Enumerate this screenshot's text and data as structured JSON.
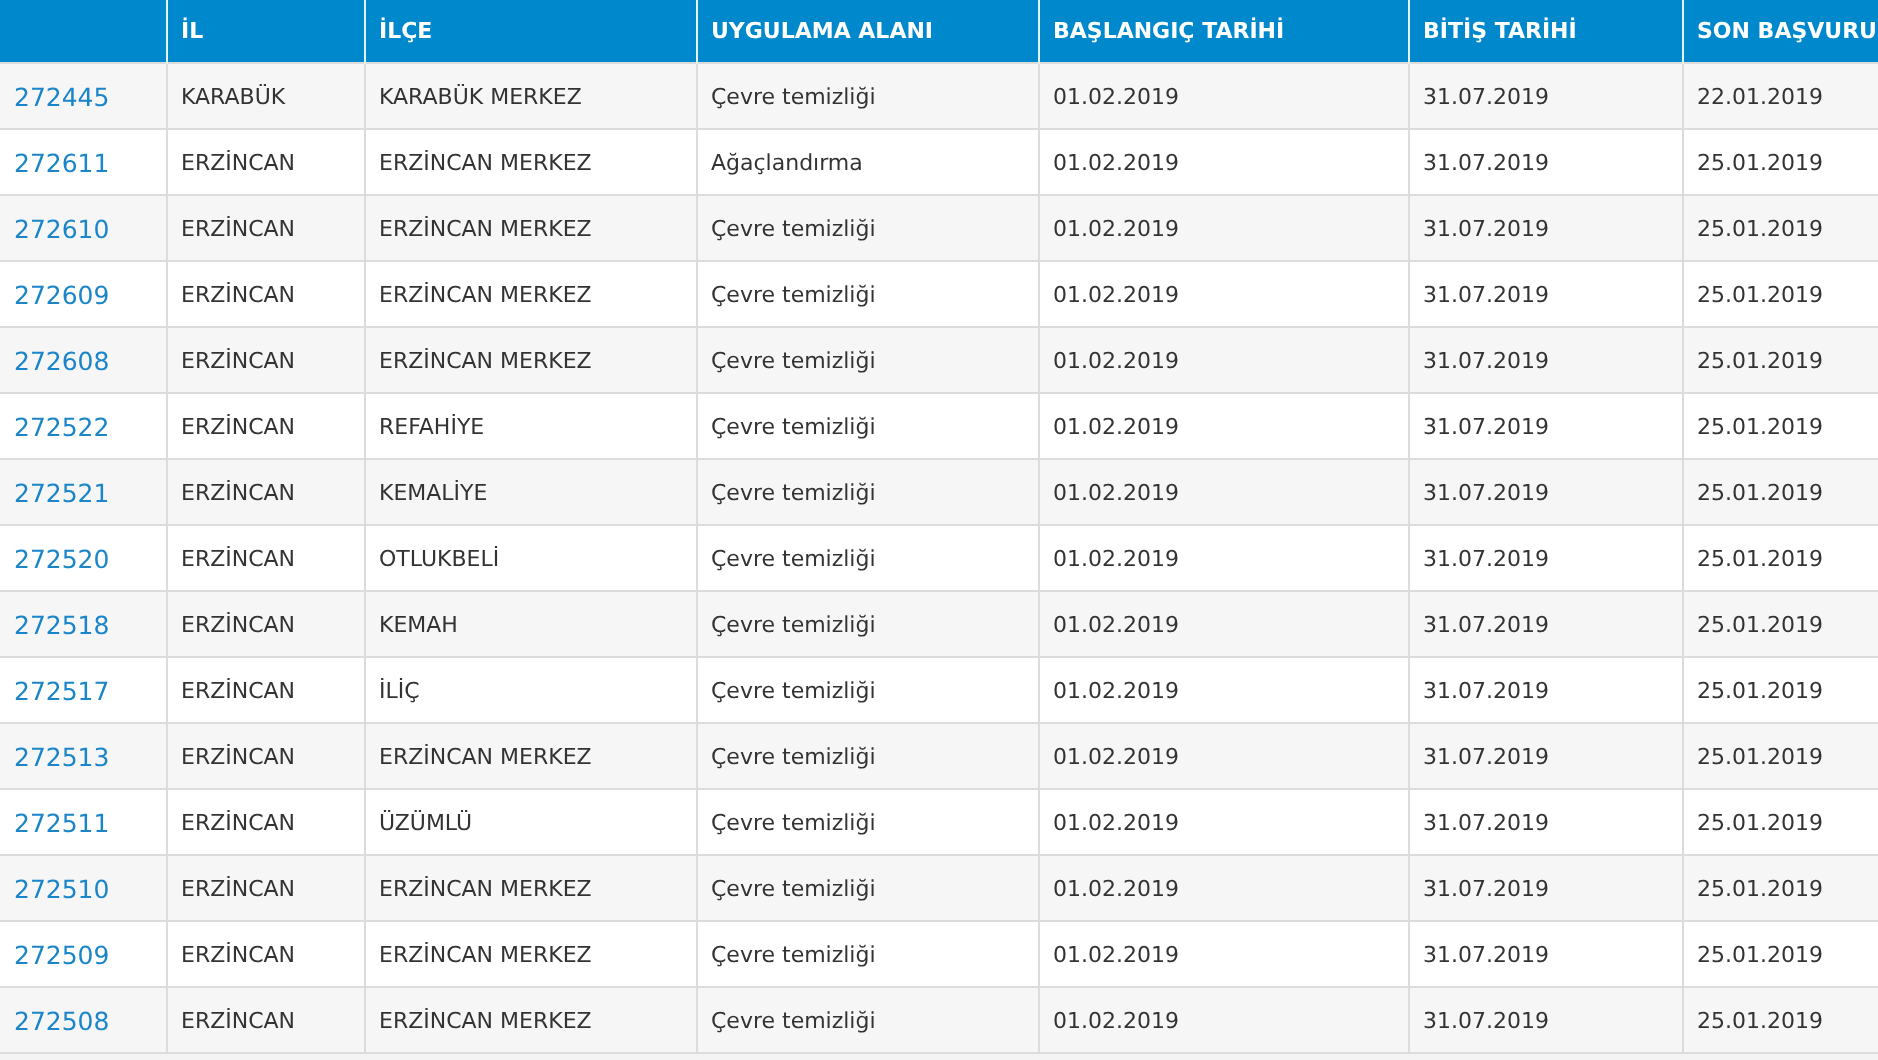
{
  "table": {
    "columns": [
      "İL",
      "İLÇE",
      "UYGULAMA ALANI",
      "BAŞLANGIÇ TARİHİ",
      "BİTİŞ TARİHİ",
      "SON BAŞVURU"
    ],
    "rows": [
      {
        "number": "272445",
        "cells": [
          "KARABÜK",
          "KARABÜK MERKEZ",
          "Çevre temizliği",
          "01.02.2019",
          "31.07.2019",
          "22.01.2019"
        ]
      },
      {
        "number": "272611",
        "cells": [
          "ERZİNCAN",
          "ERZİNCAN MERKEZ",
          "Ağaçlandırma",
          "01.02.2019",
          "31.07.2019",
          "25.01.2019"
        ]
      },
      {
        "number": "272610",
        "cells": [
          "ERZİNCAN",
          "ERZİNCAN MERKEZ",
          "Çevre temizliği",
          "01.02.2019",
          "31.07.2019",
          "25.01.2019"
        ]
      },
      {
        "number": "272609",
        "cells": [
          "ERZİNCAN",
          "ERZİNCAN MERKEZ",
          "Çevre temizliği",
          "01.02.2019",
          "31.07.2019",
          "25.01.2019"
        ]
      },
      {
        "number": "272608",
        "cells": [
          "ERZİNCAN",
          "ERZİNCAN MERKEZ",
          "Çevre temizliği",
          "01.02.2019",
          "31.07.2019",
          "25.01.2019"
        ]
      },
      {
        "number": "272522",
        "cells": [
          "ERZİNCAN",
          "REFAHİYE",
          "Çevre temizliği",
          "01.02.2019",
          "31.07.2019",
          "25.01.2019"
        ]
      },
      {
        "number": "272521",
        "cells": [
          "ERZİNCAN",
          "KEMALİYE",
          "Çevre temizliği",
          "01.02.2019",
          "31.07.2019",
          "25.01.2019"
        ]
      },
      {
        "number": "272520",
        "cells": [
          "ERZİNCAN",
          "OTLUKBELİ",
          "Çevre temizliği",
          "01.02.2019",
          "31.07.2019",
          "25.01.2019"
        ]
      },
      {
        "number": "272518",
        "cells": [
          "ERZİNCAN",
          "KEMAH",
          "Çevre temizliği",
          "01.02.2019",
          "31.07.2019",
          "25.01.2019"
        ]
      },
      {
        "number": "272517",
        "cells": [
          "ERZİNCAN",
          "İLİÇ",
          "Çevre temizliği",
          "01.02.2019",
          "31.07.2019",
          "25.01.2019"
        ]
      },
      {
        "number": "272513",
        "cells": [
          "ERZİNCAN",
          "ERZİNCAN MERKEZ",
          "Çevre temizliği",
          "01.02.2019",
          "31.07.2019",
          "25.01.2019"
        ]
      },
      {
        "number": "272511",
        "cells": [
          "ERZİNCAN",
          "ÜZÜMLÜ",
          "Çevre temizliği",
          "01.02.2019",
          "31.07.2019",
          "25.01.2019"
        ]
      },
      {
        "number": "272510",
        "cells": [
          "ERZİNCAN",
          "ERZİNCAN MERKEZ",
          "Çevre temizliği",
          "01.02.2019",
          "31.07.2019",
          "25.01.2019"
        ]
      },
      {
        "number": "272509",
        "cells": [
          "ERZİNCAN",
          "ERZİNCAN MERKEZ",
          "Çevre temizliği",
          "01.02.2019",
          "31.07.2019",
          "25.01.2019"
        ]
      },
      {
        "number": "272508",
        "cells": [
          "ERZİNCAN",
          "ERZİNCAN MERKEZ",
          "Çevre temizliği",
          "01.02.2019",
          "31.07.2019",
          "25.01.2019"
        ]
      }
    ]
  }
}
